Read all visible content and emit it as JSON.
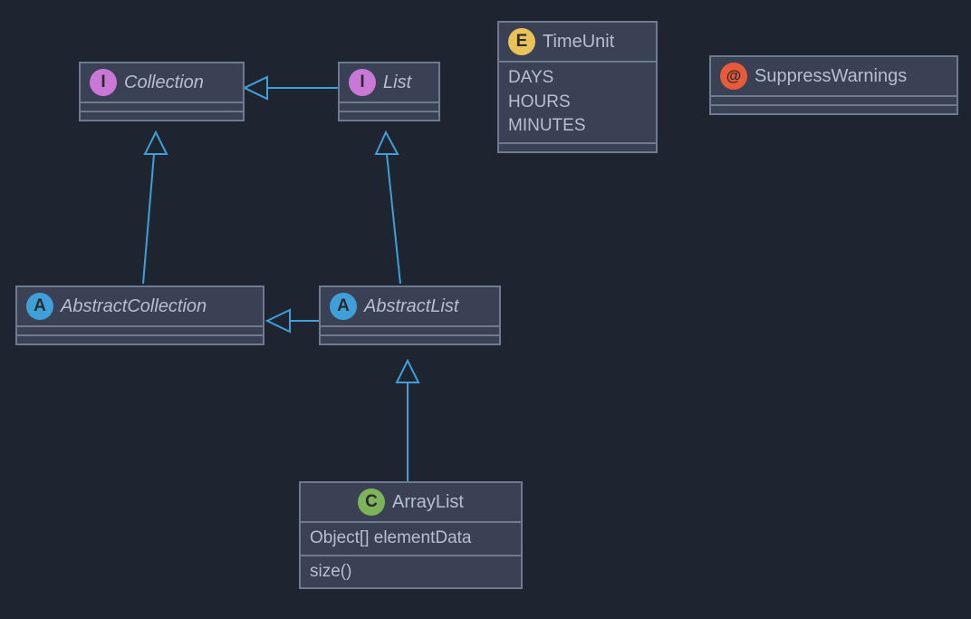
{
  "nodes": {
    "collection": {
      "badge": "I",
      "title": "Collection",
      "italic": true
    },
    "list": {
      "badge": "I",
      "title": "List",
      "italic": true
    },
    "abstractCollection": {
      "badge": "A",
      "title": "AbstractCollection",
      "italic": true
    },
    "abstractList": {
      "badge": "A",
      "title": "AbstractList",
      "italic": true
    },
    "arrayList": {
      "badge": "C",
      "title": "ArrayList",
      "fields": "Object[] elementData",
      "methods": "size()"
    },
    "timeUnit": {
      "badge": "E",
      "title": "TimeUnit",
      "values": [
        "DAYS",
        "HOURS",
        "MINUTES"
      ]
    },
    "suppressWarnings": {
      "badge": "@",
      "title": "SuppressWarnings"
    }
  }
}
